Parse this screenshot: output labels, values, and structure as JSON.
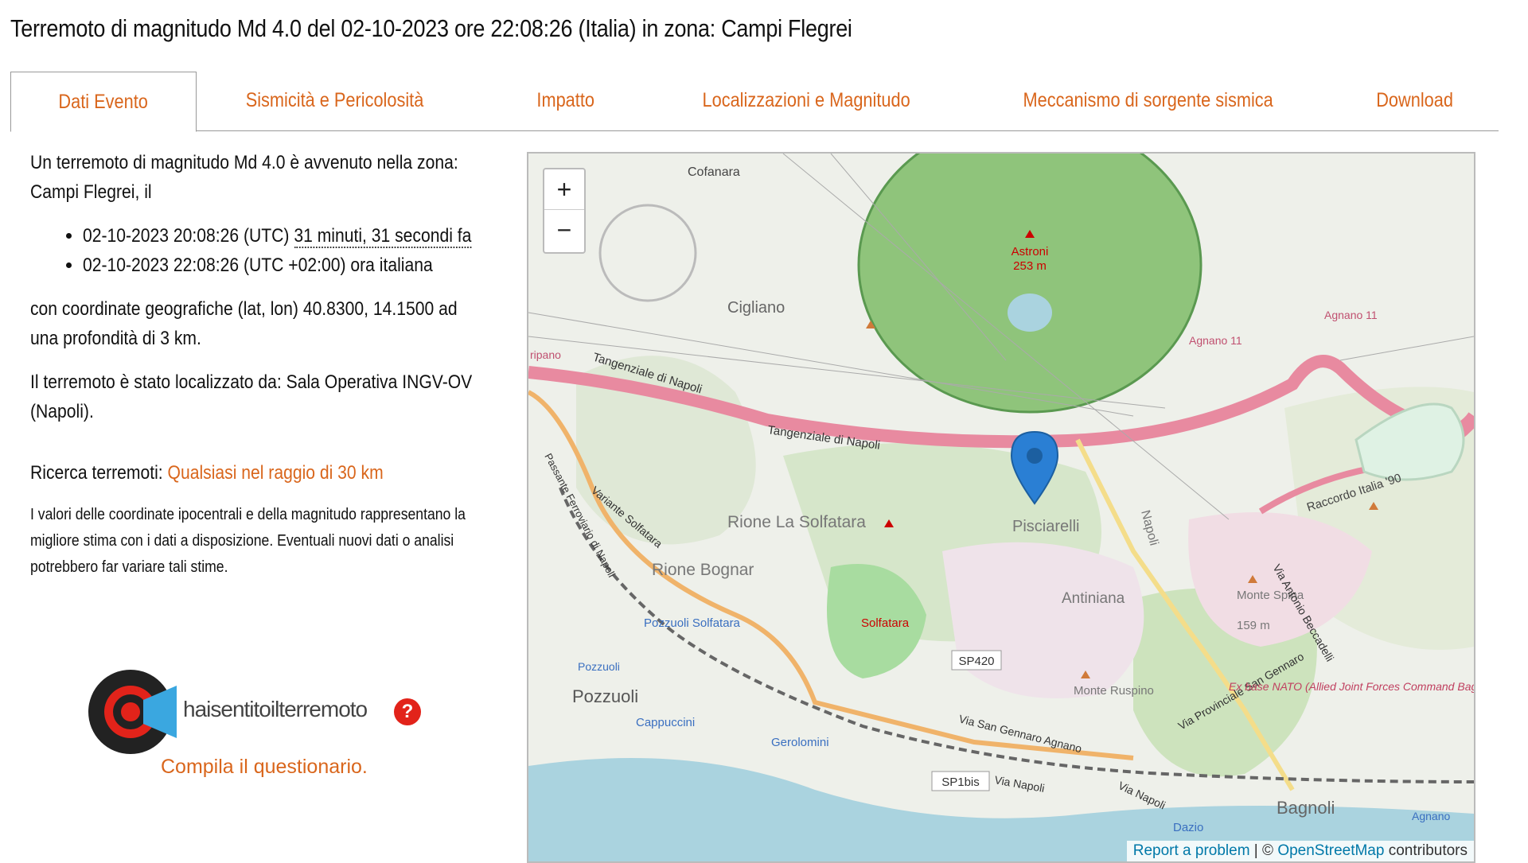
{
  "page": {
    "title": "Terremoto di magnitudo Md 4.0 del 02-10-2023 ore 22:08:26 (Italia) in zona: Campi Flegrei"
  },
  "tabs": [
    {
      "label": "Dati Evento",
      "active": true
    },
    {
      "label": "Sismicità e Pericolosità"
    },
    {
      "label": "Impatto"
    },
    {
      "label": "Localizzazioni e Magnitudo"
    },
    {
      "label": "Meccanismo di sorgente sismica"
    },
    {
      "label": "Download"
    }
  ],
  "info": {
    "intro": "Un terremoto di magnitudo Md 4.0 è avvenuto nella zona: Campi Flegrei, il",
    "utc_time": "02-10-2023 20:08:26 (UTC)",
    "ago": "31 minuti, 31 secondi fa",
    "local_time": "02-10-2023 22:08:26 (UTC +02:00) ora italiana",
    "coords": "con coordinate geografiche (lat, lon) 40.8300, 14.1500 ad una profondità di 3 km.",
    "located_by": "Il terremoto è stato localizzato da: Sala Operativa INGV-OV (Napoli).",
    "search_label": "Ricerca terremoti:",
    "search_link": "Qualsiasi nel raggio di 30 km",
    "note": "I valori delle coordinate ipocentrali e della magnitudo rappresentano la migliore stima con i dati a disposizione. Eventuali nuovi dati o analisi potrebbero far variare tali stime."
  },
  "hst": {
    "logo_text": "haisentitoilterremoto",
    "question_mark": "?",
    "cta": "Compila il questionario."
  },
  "map": {
    "zoom_in": "+",
    "zoom_out": "−",
    "labels": {
      "cofanara": "Cofanara",
      "astroni": "Astroni",
      "astroni_alt": "253 m",
      "cigliano": "Cigliano",
      "tangenziale1": "Tangenziale di Napoli",
      "tangenziale2": "Tangenziale di Napoli",
      "agnano11a": "Agnano 11",
      "agnano11b": "Agnano 11",
      "raccordo": "Raccordo Italia '90",
      "rione_solfatara": "Rione La Solfatara",
      "pisciarelli": "Pisciarelli",
      "napoli_road": "Napoli",
      "rione_bognar": "Rione Bognar",
      "variante": "Variante Solfatara",
      "passante": "Passante Ferroviario di Napoli",
      "pozzuoli_solfatara": "Pozzuoli Solfatara",
      "solfatara": "Solfatara",
      "antiniana": "Antiniana",
      "monte_spina": "Monte Spina",
      "monte_spina_alt": "159 m",
      "beccadelli": "Via Antonio Beccadelli",
      "pozzuoli_station": "Pozzuoli",
      "pozzuoli": "Pozzuoli",
      "sp420": "SP420",
      "monte_ruspino": "Monte Ruspino",
      "via_prov": "Via Provinciale San Gennaro",
      "ex_base": "Ex base NATO (Allied Joint Forces Command Bagnoli)",
      "cappuccini": "Cappuccini",
      "via_sangennaro": "Via San Gennaro Agnano",
      "pozzuoli_road": "Pozzuoli",
      "gerolomini": "Gerolomini",
      "sp1bis": "SP1bis",
      "via_napoli1": "Via Napoli",
      "via_napoli2": "Via Napoli",
      "dazio": "Dazio",
      "bagnoli": "Bagnoli",
      "agnano": "Agnano",
      "ripano": "ripano"
    },
    "attribution": {
      "report": "Report a problem",
      "sep": " | © ",
      "osm": "OpenStreetMap",
      "contrib": " contributors"
    },
    "colors": {
      "marker": "#2a7fd4",
      "highway": "#e88aa0",
      "park": "#7fb86a",
      "peak": "#cc0000"
    }
  }
}
